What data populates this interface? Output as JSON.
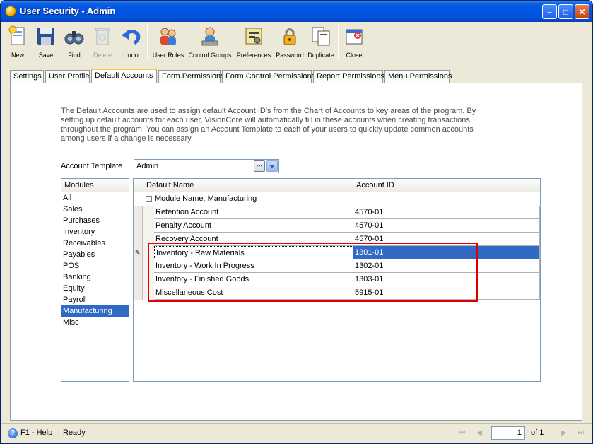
{
  "window": {
    "title": "User Security - Admin",
    "app_icon": "visioncore-app-icon"
  },
  "toolbar": {
    "items": [
      {
        "label": "New",
        "icon": "new-document-icon",
        "enabled": true
      },
      {
        "label": "Save",
        "icon": "floppy-disk-icon",
        "enabled": true
      },
      {
        "label": "Find",
        "icon": "binoculars-icon",
        "enabled": true
      },
      {
        "label": "Delete",
        "icon": "recycle-bin-icon",
        "enabled": false
      },
      {
        "label": "Undo",
        "icon": "undo-arrow-icon",
        "enabled": true
      },
      {
        "label": "User Roles",
        "icon": "user-roles-icon",
        "enabled": true
      },
      {
        "label": "Control Groups",
        "icon": "control-groups-icon",
        "enabled": true
      },
      {
        "label": "Preferences",
        "icon": "preferences-icon",
        "enabled": true
      },
      {
        "label": "Password",
        "icon": "password-lock-icon",
        "enabled": true
      },
      {
        "label": "Duplicate",
        "icon": "duplicate-icon",
        "enabled": true
      },
      {
        "label": "Close",
        "icon": "close-form-icon",
        "enabled": true
      }
    ]
  },
  "tabs": [
    {
      "label": "Settings"
    },
    {
      "label": "User Profile"
    },
    {
      "label": "Default Accounts",
      "active": true
    },
    {
      "label": "Form Permissions"
    },
    {
      "label": "Form Control Permissions"
    },
    {
      "label": "Report Permissions"
    },
    {
      "label": "Menu Permissions"
    }
  ],
  "default_accounts": {
    "description": "The Default Accounts are used to assign default Account ID's from the Chart of Accounts to key areas of the program.  By setting up default accounts for each user, VisionCore will automatically fill in these accounts when creating transactions throughout the program.  You can assign an Account Template to each of your users to quickly update common accounts among users if a change is necessary.",
    "template_label": "Account Template",
    "template_value": "Admin",
    "modules_header": "Modules",
    "modules": [
      "All",
      "Sales",
      "Purchases",
      "Inventory",
      "Receivables",
      "Payables",
      "POS",
      "Banking",
      "Equity",
      "Payroll",
      "Manufacturing",
      "Misc"
    ],
    "selected_module": "Manufacturing",
    "grid": {
      "col_name": "Default Name",
      "col_account": "Account ID",
      "group_label": "Module Name: Manufacturing",
      "rows": [
        {
          "name": "Retention Account",
          "account": "4570-01"
        },
        {
          "name": "Penalty Account",
          "account": "4570-01"
        },
        {
          "name": "Recovery Account",
          "account": "4570-01"
        },
        {
          "name": "Inventory - Raw Materials",
          "account": "1301-01",
          "active": true
        },
        {
          "name": "Inventory - Work In Progress",
          "account": "1302-01"
        },
        {
          "name": "Inventory - Finished Goods",
          "account": "1303-01"
        },
        {
          "name": "Miscellaneous Cost",
          "account": "5915-01"
        }
      ]
    }
  },
  "statusbar": {
    "help": "F1 - Help",
    "status": "Ready",
    "page": "1",
    "of": "of",
    "total": "1"
  }
}
